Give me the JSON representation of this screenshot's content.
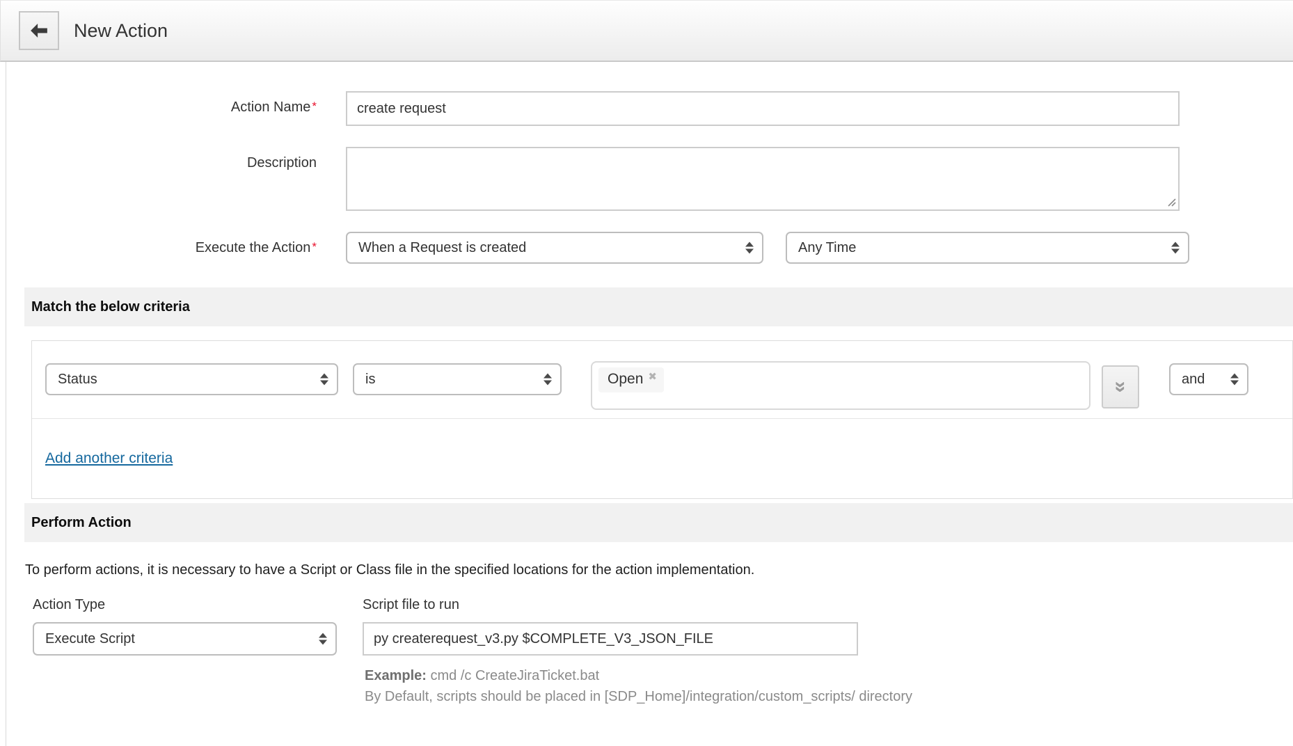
{
  "header": {
    "title": "New Action"
  },
  "form": {
    "action_name": {
      "label": "Action Name",
      "required_mark": "*",
      "value": "create request"
    },
    "description": {
      "label": "Description",
      "value": ""
    },
    "execute_action": {
      "label": "Execute the Action",
      "required_mark": "*",
      "event_value": "When a Request is created",
      "time_value": "Any Time"
    }
  },
  "criteria_section": {
    "title": "Match the below criteria",
    "row": {
      "field_value": "Status",
      "condition_value": "is",
      "selected_value": "Open",
      "remove_icon": "✖",
      "expand_icon": "»",
      "connector_value": "and"
    },
    "add_link_label": "Add another criteria"
  },
  "perform_section": {
    "title": "Perform Action",
    "note": "To perform actions, it is necessary to have a Script or Class file in the specified locations for the action implementation.",
    "action_type": {
      "label": "Action Type",
      "value": "Execute Script"
    },
    "script_file": {
      "label": "Script file to run",
      "value": "py createrequest_v3.py $COMPLETE_V3_JSON_FILE"
    },
    "example_label": "Example:",
    "example_value": "cmd /c CreateJiraTicket.bat",
    "default_note": "By Default, scripts should be placed in [SDP_Home]/integration/custom_scripts/ directory"
  }
}
